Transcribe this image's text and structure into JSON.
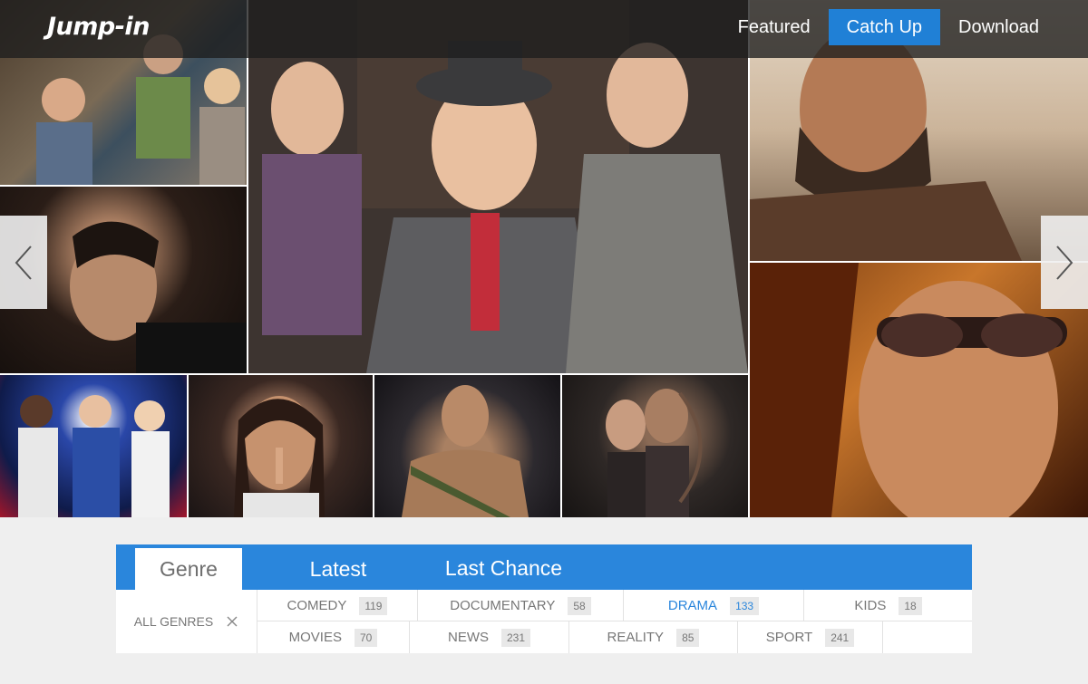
{
  "brand": {
    "logo": "Jump-in",
    "accent": "#2080d6"
  },
  "nav": {
    "items": [
      {
        "label": "Featured",
        "active": false
      },
      {
        "label": "Catch Up",
        "active": true
      },
      {
        "label": "Download",
        "active": false
      }
    ]
  },
  "hero": {
    "prev_icon": "chevron-left-icon",
    "next_icon": "chevron-right-icon"
  },
  "tabs": [
    {
      "label": "Genre",
      "active": true
    },
    {
      "label": "Latest",
      "active": false
    },
    {
      "label": "Last Chance",
      "active": false
    }
  ],
  "genres": {
    "all_label": "ALL GENRES",
    "clear_icon": "close-icon",
    "row1": [
      {
        "label": "COMEDY",
        "count": "119"
      },
      {
        "label": "DOCUMENTARY",
        "count": "58"
      },
      {
        "label": "DRAMA",
        "count": "133",
        "active": true
      },
      {
        "label": "KIDS",
        "count": "18"
      }
    ],
    "row2": [
      {
        "label": "MOVIES",
        "count": "70"
      },
      {
        "label": "NEWS",
        "count": "231"
      },
      {
        "label": "REALITY",
        "count": "85"
      },
      {
        "label": "SPORT",
        "count": "241"
      }
    ]
  }
}
